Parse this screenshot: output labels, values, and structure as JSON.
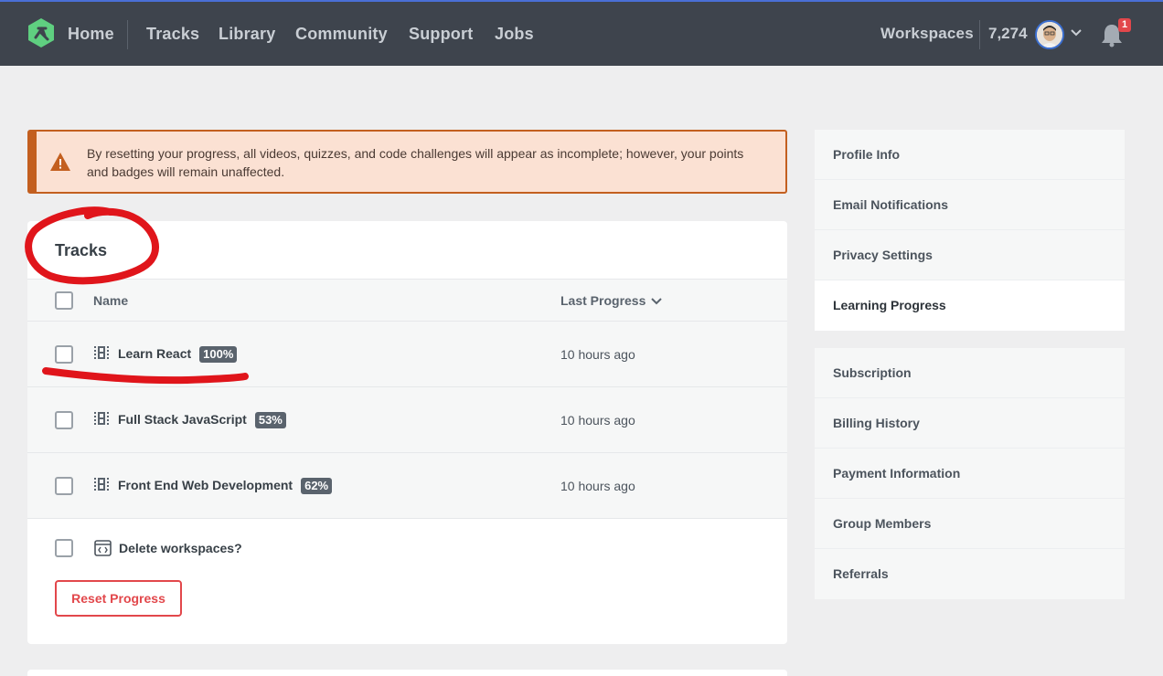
{
  "nav": {
    "home": "Home",
    "tracks": "Tracks",
    "library": "Library",
    "community": "Community",
    "support": "Support",
    "jobs": "Jobs",
    "workspaces": "Workspaces",
    "points": "7,274",
    "notification_count": "1"
  },
  "alert": {
    "text": "By resetting your progress, all videos, quizzes, and code challenges will appear as incomplete; however, your points and badges will remain unaffected."
  },
  "tracks": {
    "title": "Tracks",
    "columns": {
      "name": "Name",
      "last_progress": "Last Progress"
    },
    "rows": [
      {
        "name": "Learn React",
        "percent": "100%",
        "time": "10 hours ago"
      },
      {
        "name": "Full Stack JavaScript",
        "percent": "53%",
        "time": "10 hours ago"
      },
      {
        "name": "Front End Web Development",
        "percent": "62%",
        "time": "10 hours ago"
      }
    ],
    "delete_workspaces": "Delete workspaces?",
    "reset_button": "Reset Progress"
  },
  "sidebar": {
    "group1": [
      "Profile Info",
      "Email Notifications",
      "Privacy Settings",
      "Learning Progress"
    ],
    "active": "Learning Progress",
    "group2": [
      "Subscription",
      "Billing History",
      "Payment Information",
      "Group Members",
      "Referrals"
    ]
  },
  "colors": {
    "topbar": "#3e444d",
    "accent_green": "#5fcf80",
    "alert_bg": "#fbe1d3",
    "alert_border": "#c35f1f",
    "danger": "#e2474b",
    "annotation": "#e0151b"
  }
}
